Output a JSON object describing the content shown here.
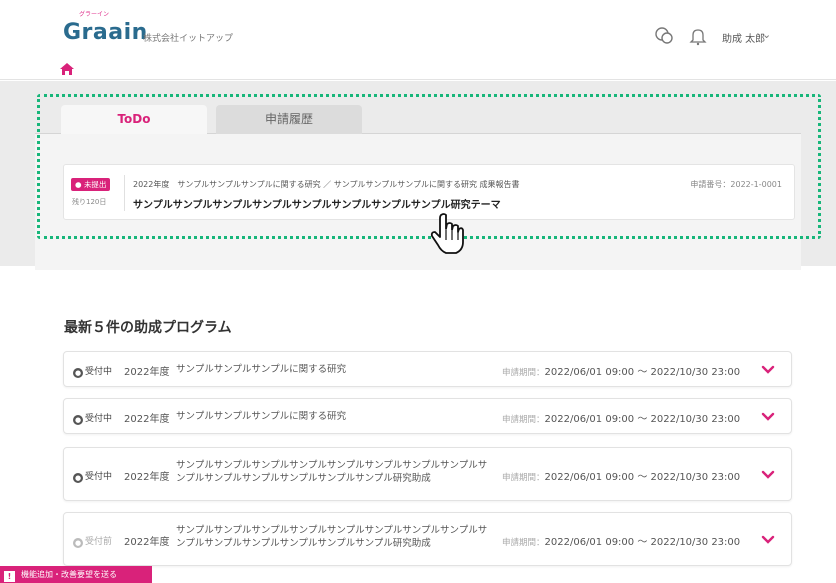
{
  "header": {
    "logo": "Graain",
    "logo_ruby": "グラーイン",
    "company": "株式会社イットアップ",
    "user_name": "助成 太郎",
    "icons": [
      "chat-icon",
      "bell-icon",
      "chevron-down-icon",
      "home-icon"
    ]
  },
  "tabs": [
    {
      "label": "ToDo",
      "active": true
    },
    {
      "label": "申請履歴",
      "active": false
    }
  ],
  "todo": {
    "badge": "未提出",
    "remaining": "残り120日",
    "meta": "2022年度　サンプルサンプルサンプルに関する研究 ／ サンプルサンプルサンプルに関する研究 成果報告書",
    "title": "サンプルサンプルサンプルサンプルサンプルサンプルサンプルサンプル研究テーマ",
    "application_no": "申請番号：2022-1-0001"
  },
  "programs": {
    "title": "最新５件の助成プログラム",
    "period_label": "申請期間：",
    "items": [
      {
        "status": "受付中",
        "year": "2022年度",
        "name": "サンプルサンプルサンプルに関する研究",
        "period": "2022/06/01 09:00 ～ 2022/10/30 23:00"
      },
      {
        "status": "受付中",
        "year": "2022年度",
        "name": "サンプルサンプルサンプルに関する研究",
        "period": "2022/06/01 09:00 ～ 2022/10/30 23:00"
      },
      {
        "status": "受付中",
        "year": "2022年度",
        "name": "サンプルサンプルサンプルサンプルサンプルサンプルサンプルサンプルサンプルサンプルサンプルサンプルサンプルサンプル研究助成",
        "period": "2022/06/01 09:00 ～ 2022/10/30 23:00"
      },
      {
        "status": "受付前",
        "year": "2022年度",
        "name": "サンプルサンプルサンプルサンプルサンプルサンプルサンプルサンプルサンプルサンプルサンプルサンプルサンプルサンプル研究助成",
        "period": "2022/06/01 09:00 ～ 2022/10/30 23:00"
      }
    ]
  },
  "feedback": {
    "label": "機能追加・改善要望を送る"
  },
  "colors": {
    "brand": "#2a6b8e",
    "accent": "#d9227a",
    "highlight": "#17b67a"
  }
}
